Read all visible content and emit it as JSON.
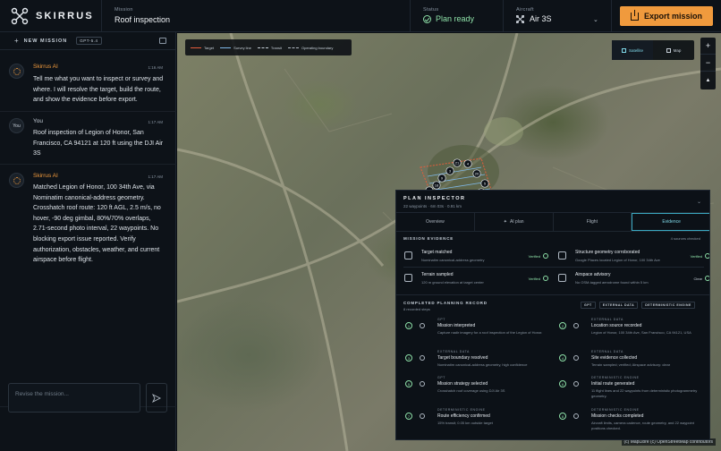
{
  "app": {
    "name": "SKIRRUS",
    "mission_label": "Mission",
    "mission_title": "Roof inspection",
    "status_label": "Status",
    "status_value": "Plan ready",
    "aircraft_label": "Aircraft",
    "aircraft_value": "Air 3S",
    "export_label": "Export mission",
    "accent": "#f09a3d"
  },
  "chat": {
    "new_mission_label": "NEW MISSION",
    "model_chip": "GPT-5.4",
    "input_placeholder": "Revise the mission...",
    "messages": [
      {
        "author": "Skirrus AI",
        "time": "1:16 AM",
        "text": "Tell me what you want to inspect or survey and where. I will resolve the target, build the route, and show the evidence before export."
      },
      {
        "author": "You",
        "avatar": "You",
        "time": "1:17 AM",
        "text": "Roof inspection of Legion of Honor, San Francisco, CA 94121 at 120 ft using the DJI Air 3S"
      },
      {
        "author": "Skirrus AI",
        "time": "1:17 AM",
        "text": "Matched Legion of Honor, 100 34th Ave, via Nominatim canonical-address geometry. Crosshatch roof route: 120 ft AGL, 2.5 m/s, no hover, -90 deg gimbal, 80%/70% overlaps, 2.71-second photo interval, 22 waypoints. No blocking export issue reported. Verify authorization, obstacles, weather, and current airspace before flight."
      }
    ]
  },
  "map": {
    "legend": [
      "Target",
      "Survey line",
      "Transit",
      "Operating boundary"
    ],
    "layers": [
      "Satellite",
      "Map"
    ],
    "active_layer": "Satellite",
    "attribution": "(c) MapLibre (c) OpenStreetMap contributors",
    "waypoints": [
      "21",
      "4",
      "3",
      "20",
      "9",
      "5",
      "18",
      "2",
      "17",
      "1",
      "16",
      "6",
      "15",
      "7"
    ]
  },
  "inspector": {
    "title": "PLAN INSPECTOR",
    "subtitle": "22 waypoints · 6m 03s · 0.91 km",
    "tabs": [
      "Overview",
      "AI plan",
      "Flight",
      "Evidence"
    ],
    "active_tab": "Evidence",
    "evidence_title": "MISSION EVIDENCE",
    "evidence_count": "4 sources checked",
    "evidence": [
      {
        "title": "Target matched",
        "desc": "Nominatim canonical-address geometry",
        "status": "Verified"
      },
      {
        "title": "Structure geometry corroborated",
        "desc": "Google Places located Legion of Honor, 100 34th Ave",
        "status": "Verified"
      },
      {
        "title": "Terrain sampled",
        "desc": "120 m ground elevation at target center",
        "status": "Verified"
      },
      {
        "title": "Airspace advisory",
        "desc": "No OSM-tagged aerodrome found within 5 km",
        "status": "Clear"
      }
    ],
    "record_title": "COMPLETED PLANNING RECORD",
    "record_sub": "8 recorded steps",
    "chips": [
      "GPT",
      "EXTERNAL DATA",
      "DETERMINISTIC ENGINE"
    ],
    "steps": [
      {
        "n": "1",
        "kind": "GPT",
        "title": "Mission interpreted",
        "desc": "Capture nadir imagery for a roof inspection of the Legion of Honor."
      },
      {
        "n": "2",
        "kind": "EXTERNAL DATA",
        "title": "Location source recorded",
        "desc": "Legion of Honor, 100 34th Ave, San Francisco, CA 94121, USA"
      },
      {
        "n": "3",
        "kind": "EXTERNAL DATA",
        "title": "Target boundary resolved",
        "desc": "Nominatim canonical-address geometry, high confidence"
      },
      {
        "n": "4",
        "kind": "EXTERNAL DATA",
        "title": "Site evidence collected",
        "desc": "Terrain sampled; verified; Airspace advisory: clear"
      },
      {
        "n": "5",
        "kind": "GPT",
        "title": "Mission strategy selected",
        "desc": "Crosshatch roof coverage using DJI Air 3S"
      },
      {
        "n": "6",
        "kind": "DETERMINISTIC ENGINE",
        "title": "Initial route generated",
        "desc": "11 flight lines and 22 waypoints from deterministic photogrammetry geometry."
      },
      {
        "n": "7",
        "kind": "DETERMINISTIC ENGINE",
        "title": "Route efficiency confirmed",
        "desc": "15% transit; 0.05 km outside target"
      },
      {
        "n": "8",
        "kind": "DETERMINISTIC ENGINE",
        "title": "Mission checks completed",
        "desc": "Aircraft limits, camera cadence, route geometry, and 22 waypoint positions checked."
      }
    ]
  }
}
